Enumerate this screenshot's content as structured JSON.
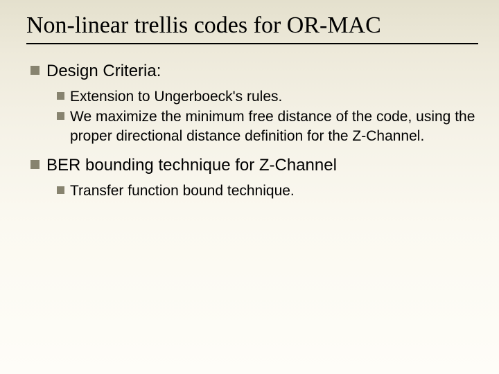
{
  "title": "Non-linear trellis codes for OR-MAC",
  "items": [
    {
      "label": "Design Criteria:",
      "children": [
        {
          "label": "Extension to Ungerboeck's rules."
        },
        {
          "label": "We maximize the minimum free distance of the code, using the proper directional distance definition for the Z-Channel."
        }
      ]
    },
    {
      "label": "BER bounding technique for Z-Channel",
      "children": [
        {
          "label": "Transfer function bound technique."
        }
      ]
    }
  ]
}
